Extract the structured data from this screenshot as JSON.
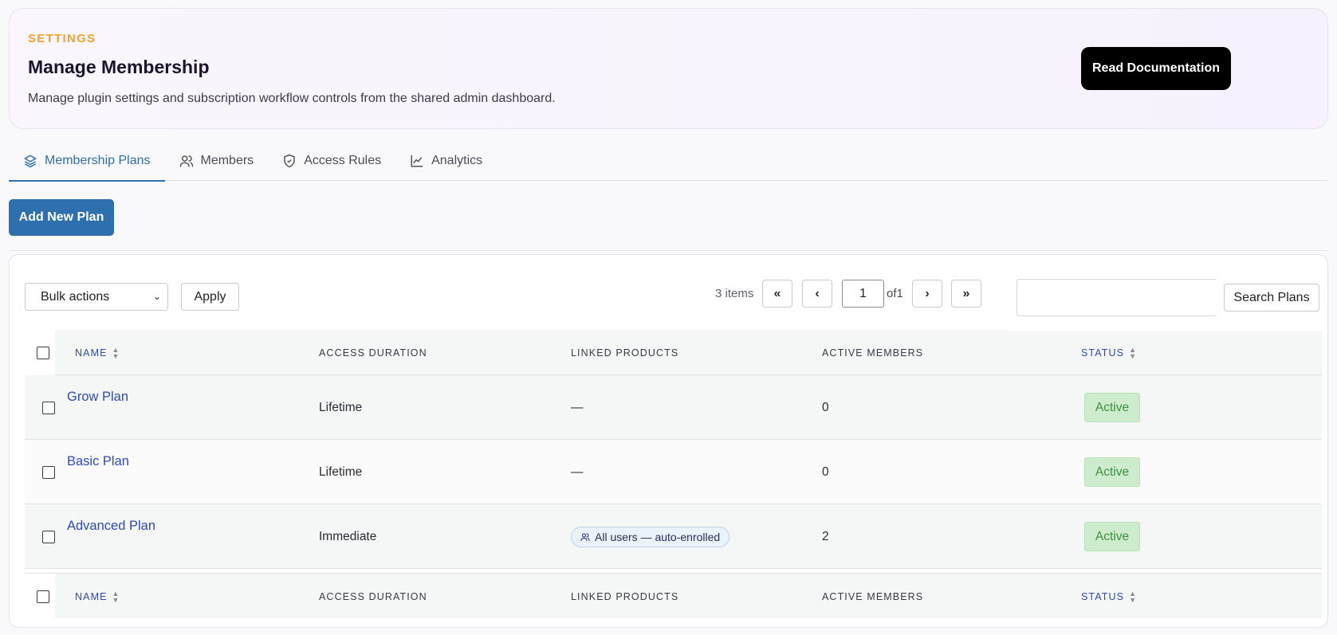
{
  "header": {
    "eyebrow": "SETTINGS",
    "title": "Manage Membership",
    "description": "Manage plugin settings and subscription workflow controls from the shared admin dashboard.",
    "doc_button": "Read Documentation"
  },
  "tabs": [
    {
      "label": "Membership Plans",
      "icon": "layers-icon",
      "active": true
    },
    {
      "label": "Members",
      "icon": "users-icon",
      "active": false
    },
    {
      "label": "Access Rules",
      "icon": "shield-check-icon",
      "active": false
    },
    {
      "label": "Analytics",
      "icon": "line-chart-icon",
      "active": false
    }
  ],
  "add_button": "Add New Plan",
  "toolbar": {
    "bulk_select": "Bulk actions",
    "apply": "Apply",
    "items_count": "3 items",
    "first": "«",
    "prev": "‹",
    "current_page": "1",
    "of_total": "of1",
    "next": "›",
    "last": "»",
    "search_button": "Search Plans"
  },
  "columns": {
    "name": "NAME",
    "access_duration": "ACCESS DURATION",
    "linked_products": "LINKED PRODUCTS",
    "active_members": "ACTIVE MEMBERS",
    "status": "STATUS"
  },
  "rows": [
    {
      "name": "Grow Plan",
      "duration": "Lifetime",
      "linked": "—",
      "members": "0",
      "status": "Active"
    },
    {
      "name": "Basic Plan",
      "duration": "Lifetime",
      "linked": "—",
      "members": "0",
      "status": "Active"
    },
    {
      "name": "Advanced Plan",
      "duration": "Immediate",
      "linked_pill": "All users — auto-enrolled",
      "members": "2",
      "status": "Active"
    }
  ],
  "colors": {
    "accent": "#2e6fad",
    "eyebrow": "#f0a22e",
    "link": "#2f49b8",
    "status_active_bg": "#cceccd",
    "status_active_text": "#3e8f3f"
  }
}
